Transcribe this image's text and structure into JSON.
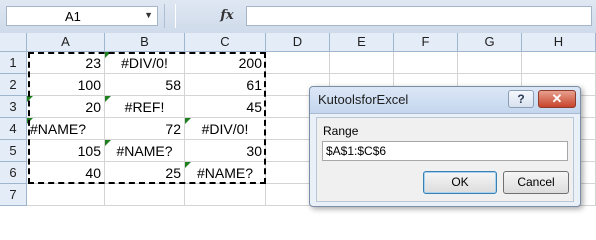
{
  "formula_bar": {
    "name_box": "A1",
    "fx_label": "fx",
    "content": ""
  },
  "columns": [
    "A",
    "B",
    "C",
    "D",
    "E",
    "F",
    "G",
    "H"
  ],
  "rows": [
    "1",
    "2",
    "3",
    "4",
    "5",
    "6",
    "7"
  ],
  "cells": [
    [
      "23",
      "#DIV/0!",
      "200"
    ],
    [
      "100",
      "58",
      "61"
    ],
    [
      "20",
      "#REF!",
      "45"
    ],
    [
      "#NAME?",
      "72",
      "#DIV/0!"
    ],
    [
      "105",
      "#NAME?",
      "30"
    ],
    [
      "40",
      "25",
      "#NAME?"
    ]
  ],
  "dialog": {
    "title": "KutoolsforExcel",
    "help_label": "?",
    "close_label": "✕",
    "range_label": "Range",
    "range_value": "$A$1:$C$6",
    "ok_label": "OK",
    "cancel_label": "Cancel"
  },
  "colors": {
    "error_indicator": "#208020",
    "header_bg": "#e4ecf7",
    "dialog_bg": "#e9f0f8"
  }
}
